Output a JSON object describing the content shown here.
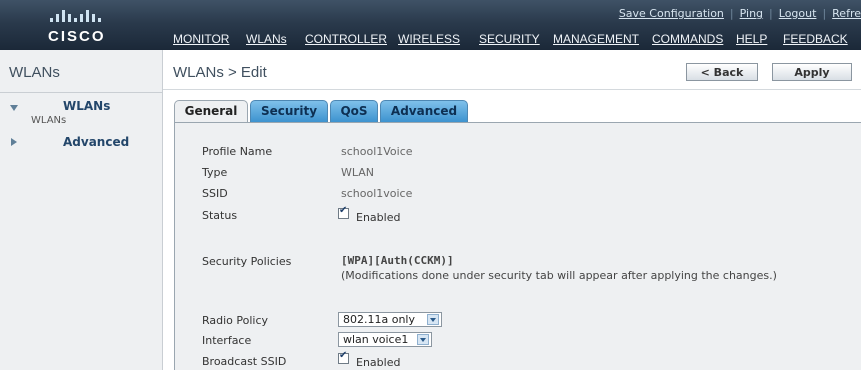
{
  "brand": {
    "logo_text": "CISCO"
  },
  "utility": {
    "save_configuration": "Save Configuration",
    "ping": "Ping",
    "logout": "Logout",
    "refresh": "Refre"
  },
  "mainnav": {
    "items": [
      "MONITOR",
      "WLANs",
      "CONTROLLER",
      "WIRELESS",
      "SECURITY",
      "MANAGEMENT",
      "COMMANDS",
      "HELP",
      "FEEDBACK"
    ],
    "active": "WLANs"
  },
  "sidebar": {
    "title": "WLANs",
    "items": [
      {
        "label": "WLANs",
        "sublabel": "WLANs",
        "expanded": true
      },
      {
        "label": "Advanced",
        "expanded": false
      }
    ]
  },
  "content": {
    "title": "WLANs > Edit",
    "back_label": "< Back",
    "apply_label": "Apply"
  },
  "tabs": {
    "items": [
      "General",
      "Security",
      "QoS",
      "Advanced"
    ],
    "active": "General"
  },
  "form": {
    "profile_name_label": "Profile Name",
    "profile_name_value": "school1Voice",
    "type_label": "Type",
    "type_value": "WLAN",
    "ssid_label": "SSID",
    "ssid_value": "school1voice",
    "status_label": "Status",
    "status_checkbox_label": "Enabled",
    "status_checked": true,
    "security_policies_label": "Security Policies",
    "security_policies_value": "[WPA][Auth(CCKM)]",
    "security_policies_note": "(Modifications done under security tab will appear after applying the changes.)",
    "radio_policy_label": "Radio Policy",
    "radio_policy_value": "802.11a only",
    "interface_label": "Interface",
    "interface_value": "wlan voice1",
    "broadcast_ssid_label": "Broadcast SSID",
    "broadcast_ssid_checkbox_label": "Enabled",
    "broadcast_ssid_checked": true
  },
  "colors": {
    "header_dark": "#1b2838",
    "tab_blue": "#3d93cf",
    "panel_bg": "#eef0f2",
    "link_blue": "#23466a"
  }
}
